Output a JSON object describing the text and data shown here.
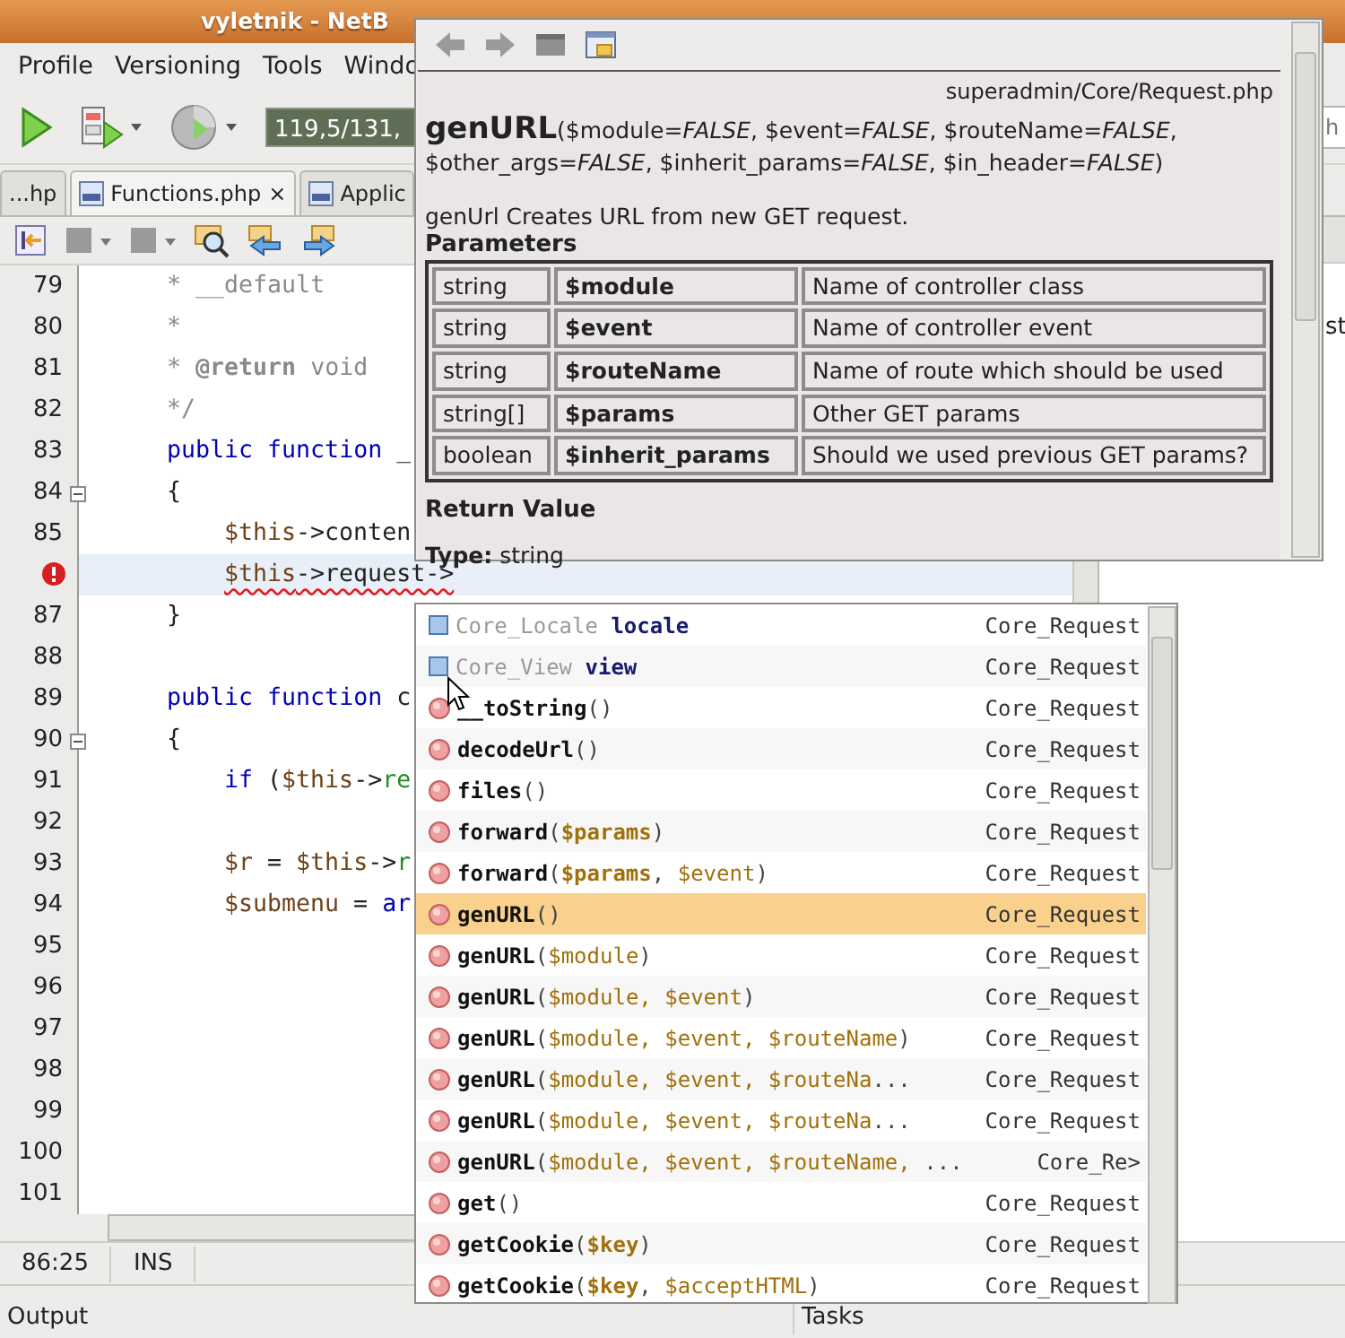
{
  "window": {
    "title": "vyletnik - NetB"
  },
  "menu": [
    {
      "label": "Profile"
    },
    {
      "label": "Versioning"
    },
    {
      "label": "Tools"
    },
    {
      "label": "Windo"
    }
  ],
  "toolbar": {
    "memory": "119,5/131,"
  },
  "search": {
    "placeholder": "h"
  },
  "tabs": [
    {
      "label": "...hp",
      "selected": false
    },
    {
      "label": "Functions.php",
      "selected": true,
      "close": "×"
    },
    {
      "label": "Applic",
      "selected": false
    }
  ],
  "editor": {
    "lines": [
      {
        "number": "79",
        "current": false,
        "error": false,
        "foldable": false,
        "tokens": [
          {
            "text": "* __default",
            "kind": "comment"
          }
        ]
      },
      {
        "number": "80",
        "current": false,
        "error": false,
        "foldable": false,
        "tokens": [
          {
            "text": "*",
            "kind": "comment"
          }
        ]
      },
      {
        "number": "81",
        "current": false,
        "error": false,
        "foldable": false,
        "tokens": [
          {
            "text": "* ",
            "kind": "comment"
          },
          {
            "text": "@return",
            "kind": "doctag"
          },
          {
            "text": " void",
            "kind": "comment"
          }
        ]
      },
      {
        "number": "82",
        "current": false,
        "error": false,
        "foldable": false,
        "tokens": [
          {
            "text": "*/",
            "kind": "comment"
          }
        ]
      },
      {
        "number": "83",
        "current": false,
        "error": false,
        "foldable": false,
        "tokens": [
          {
            "text": "public function",
            "kind": "keyword"
          },
          {
            "text": " _",
            "kind": "plain"
          }
        ]
      },
      {
        "number": "84",
        "current": false,
        "error": false,
        "foldable": true,
        "tokens": [
          {
            "text": "{",
            "kind": "plain"
          }
        ],
        "children": [
          {
            "number": "85",
            "current": false,
            "error": false,
            "foldable": false,
            "tokens": [
              {
                "text": "$this",
                "kind": "variable"
              },
              {
                "text": "->conten",
                "kind": "plain"
              }
            ]
          },
          {
            "current": true,
            "error": true,
            "foldable": false,
            "tokens": [
              {
                "text": "$this",
                "kind": "variable"
              },
              {
                "text": "->request->",
                "kind": "plain"
              }
            ]
          }
        ]
      },
      {
        "number": "87",
        "current": false,
        "error": false,
        "foldable": false,
        "tokens": [
          {
            "text": "}",
            "kind": "plain"
          }
        ]
      },
      {
        "number": "88",
        "current": false,
        "error": false,
        "foldable": false
      },
      {
        "number": "89",
        "current": false,
        "error": false,
        "foldable": false,
        "tokens": [
          {
            "text": "public function",
            "kind": "keyword"
          },
          {
            "text": " c",
            "kind": "plain"
          }
        ]
      },
      {
        "number": "90",
        "current": false,
        "error": false,
        "foldable": true,
        "tokens": [
          {
            "text": "{",
            "kind": "plain"
          }
        ],
        "children": [
          {
            "number": "91",
            "current": false,
            "error": false,
            "foldable": false,
            "tokens": [
              {
                "text": "if",
                "kind": "keyword"
              },
              {
                "text": " (",
                "kind": "plain"
              },
              {
                "text": "$this",
                "kind": "variable"
              },
              {
                "text": "->",
                "kind": "plain"
              },
              {
                "text": "re",
                "kind": "field"
              }
            ]
          },
          {
            "number": "92",
            "current": false,
            "error": false,
            "foldable": false
          },
          {
            "number": "93",
            "current": false,
            "error": false,
            "foldable": false,
            "tokens": [
              {
                "text": "$r",
                "kind": "variable"
              },
              {
                "text": " = ",
                "kind": "plain"
              },
              {
                "text": "$this",
                "kind": "variable"
              },
              {
                "text": "->",
                "kind": "plain"
              },
              {
                "text": "r",
                "kind": "field"
              }
            ]
          },
          {
            "number": "94",
            "current": false,
            "error": false,
            "foldable": false,
            "tokens": [
              {
                "text": "$submenu",
                "kind": "variable"
              },
              {
                "text": " = ",
                "kind": "plain"
              },
              {
                "text": "ar",
                "kind": "keyword"
              }
            ]
          },
          {
            "number": "95",
            "current": false,
            "error": false,
            "foldable": false
          },
          {
            "number": "96",
            "current": false,
            "error": false,
            "foldable": false
          },
          {
            "number": "97",
            "current": false,
            "error": false,
            "foldable": false
          },
          {
            "number": "98",
            "current": false,
            "error": false,
            "foldable": false
          },
          {
            "number": "99",
            "current": false,
            "error": false,
            "foldable": false
          },
          {
            "number": "100",
            "current": false,
            "error": false,
            "foldable": false
          },
          {
            "number": "101",
            "current": false,
            "error": false,
            "foldable": false
          }
        ]
      }
    ]
  },
  "side_panel": {
    "text": "st"
  },
  "status_bar": {
    "position": "86:25",
    "mode": "INS"
  },
  "bottom_tabs": [
    {
      "label": "Output"
    },
    {
      "label": "Tasks"
    }
  ],
  "doc": {
    "path": "superadmin/Core/Request.php",
    "name": "genURL",
    "signature": "($module=*FALSE*, $event=*FALSE*, $routeName=*FALSE*, $other_args=*FALSE*, $inherit_params=*FALSE*, $in_header=*FALSE*)",
    "description": "genUrl Creates URL from new GET request.",
    "parameters_heading": "Parameters",
    "parameters": [
      {
        "type": "string",
        "name": "$module",
        "description": "Name of controller class"
      },
      {
        "type": "string",
        "name": "$event",
        "description": "Name of controller event"
      },
      {
        "type": "string",
        "name": "$routeName",
        "description": "Name of route which should be used"
      },
      {
        "type": "string[]",
        "name": "$params",
        "description": "Other GET params"
      },
      {
        "type": "boolean",
        "name": "$inherit_params",
        "description": "Should we used previous GET params?"
      }
    ],
    "return_heading": "Return Value",
    "return": "**Type:** string"
  },
  "completion": {
    "items": [
      {
        "kind": "field",
        "selected": false,
        "parts": [
          {
            "text": "Core_Locale",
            "kind": "type"
          },
          {
            "text": "locale",
            "kind": "field"
          }
        ],
        "owner": "Core_Request"
      },
      {
        "kind": "field",
        "selected": false,
        "parts": [
          {
            "text": "Core_View",
            "kind": "type"
          },
          {
            "text": "view",
            "kind": "field"
          }
        ],
        "owner": "Core_Request"
      },
      {
        "kind": "method",
        "selected": false,
        "parts": [
          {
            "text": "__toString",
            "kind": "name"
          },
          {
            "text": "()",
            "kind": "punct"
          }
        ],
        "owner": "Core_Request"
      },
      {
        "kind": "method",
        "selected": false,
        "parts": [
          {
            "text": "decodeUrl",
            "kind": "name"
          },
          {
            "text": "()",
            "kind": "punct"
          }
        ],
        "owner": "Core_Request"
      },
      {
        "kind": "method",
        "selected": false,
        "parts": [
          {
            "text": "files",
            "kind": "name"
          },
          {
            "text": "()",
            "kind": "punct"
          }
        ],
        "owner": "Core_Request"
      },
      {
        "kind": "method",
        "selected": false,
        "parts": [
          {
            "text": "forward",
            "kind": "name"
          },
          {
            "text": "(",
            "kind": "punct"
          },
          {
            "text": "$params",
            "kind": "param-strong"
          },
          {
            "text": ")",
            "kind": "punct"
          }
        ],
        "owner": "Core_Request"
      },
      {
        "kind": "method",
        "selected": false,
        "parts": [
          {
            "text": "forward",
            "kind": "name"
          },
          {
            "text": "(",
            "kind": "punct"
          },
          {
            "text": "$params",
            "kind": "param-strong"
          },
          {
            "text": ", ",
            "kind": "punct"
          },
          {
            "text": "$event",
            "kind": "param"
          },
          {
            "text": ")",
            "kind": "punct"
          }
        ],
        "owner": "Core_Request"
      },
      {
        "kind": "method",
        "selected": true,
        "parts": [
          {
            "text": "genURL",
            "kind": "name"
          },
          {
            "text": "()",
            "kind": "punct"
          }
        ],
        "owner": "Core_Request"
      },
      {
        "kind": "method",
        "selected": false,
        "parts": [
          {
            "text": "genURL",
            "kind": "name"
          },
          {
            "text": "(",
            "kind": "punct"
          },
          {
            "text": "$module",
            "kind": "param"
          },
          {
            "text": ")",
            "kind": "punct"
          }
        ],
        "owner": "Core_Request"
      },
      {
        "kind": "method",
        "selected": false,
        "parts": [
          {
            "text": "genURL",
            "kind": "name"
          },
          {
            "text": "(",
            "kind": "punct"
          },
          {
            "text": "$module, $event",
            "kind": "param"
          },
          {
            "text": ")",
            "kind": "punct"
          }
        ],
        "owner": "Core_Request"
      },
      {
        "kind": "method",
        "selected": false,
        "parts": [
          {
            "text": "genURL",
            "kind": "name"
          },
          {
            "text": "(",
            "kind": "punct"
          },
          {
            "text": "$module, $event, $routeName",
            "kind": "param"
          },
          {
            "text": ")",
            "kind": "punct"
          }
        ],
        "owner": "Core_Request"
      },
      {
        "kind": "method",
        "selected": false,
        "parts": [
          {
            "text": "genURL",
            "kind": "name"
          },
          {
            "text": "(",
            "kind": "punct"
          },
          {
            "text": "$module, $event, $routeNa",
            "kind": "param"
          },
          {
            "text": "...",
            "kind": "punct"
          }
        ],
        "owner": "Core_Request"
      },
      {
        "kind": "method",
        "selected": false,
        "parts": [
          {
            "text": "genURL",
            "kind": "name"
          },
          {
            "text": "(",
            "kind": "punct"
          },
          {
            "text": "$module, $event, $routeNa",
            "kind": "param"
          },
          {
            "text": "...",
            "kind": "punct"
          }
        ],
        "owner": "Core_Request"
      },
      {
        "kind": "method",
        "selected": false,
        "parts": [
          {
            "text": "genURL",
            "kind": "name"
          },
          {
            "text": "(",
            "kind": "punct"
          },
          {
            "text": "$module, $event, $routeName,",
            "kind": "param"
          },
          {
            "text": " ...",
            "kind": "punct"
          }
        ],
        "owner": "Core_Re>"
      },
      {
        "kind": "method",
        "selected": false,
        "parts": [
          {
            "text": "get",
            "kind": "name"
          },
          {
            "text": "()",
            "kind": "punct"
          }
        ],
        "owner": "Core_Request"
      },
      {
        "kind": "method",
        "selected": false,
        "parts": [
          {
            "text": "getCookie",
            "kind": "name"
          },
          {
            "text": "(",
            "kind": "punct"
          },
          {
            "text": "$key",
            "kind": "param-strong"
          },
          {
            "text": ")",
            "kind": "punct"
          }
        ],
        "owner": "Core_Request"
      },
      {
        "kind": "method",
        "selected": false,
        "parts": [
          {
            "text": "getCookie",
            "kind": "name"
          },
          {
            "text": "(",
            "kind": "punct"
          },
          {
            "text": "$key",
            "kind": "param-strong"
          },
          {
            "text": ", ",
            "kind": "punct"
          },
          {
            "text": "$acceptHTML",
            "kind": "param"
          },
          {
            "text": ")",
            "kind": "punct"
          }
        ],
        "owner": "Core_Request"
      }
    ]
  }
}
